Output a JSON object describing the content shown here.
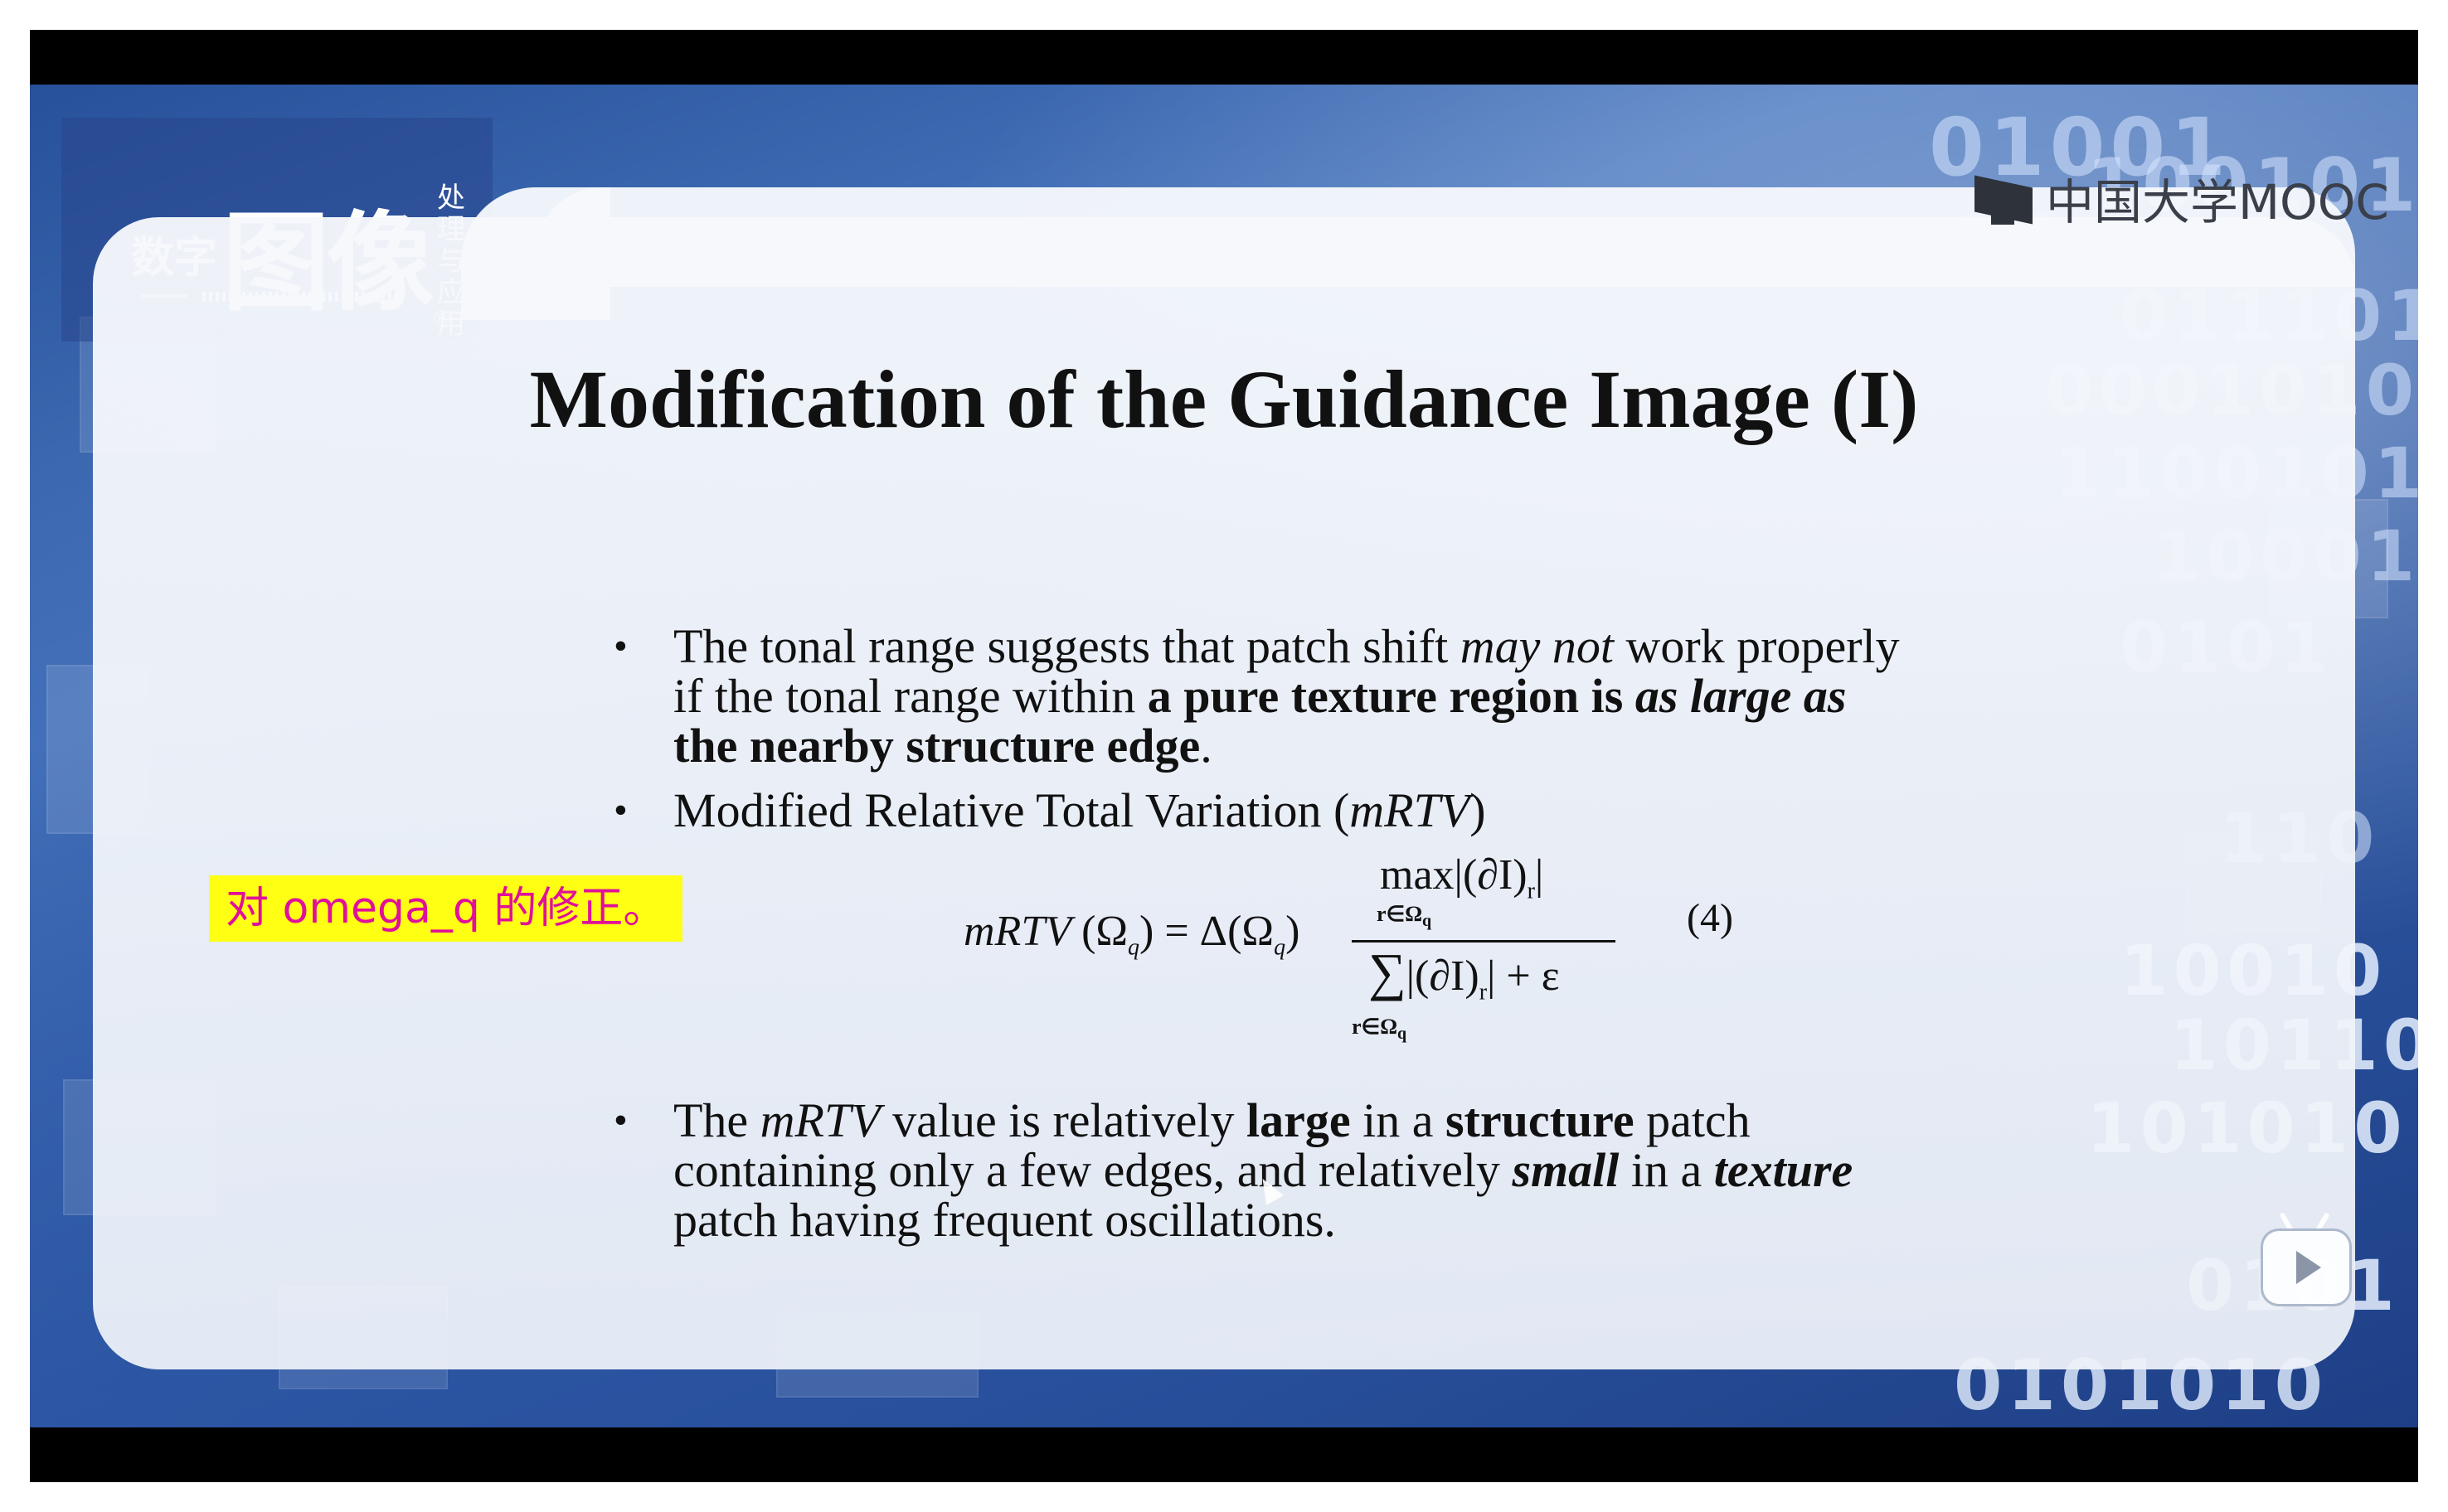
{
  "branding": {
    "logo_small": "数字",
    "logo_big": "图像",
    "logo_registered": "®",
    "logo_vertical": "处理与应用",
    "platform": "中国大学MOOC"
  },
  "slide": {
    "title": "Modification of the Guidance Image (I)",
    "bullet_marker": "•",
    "bullet1": {
      "t1": "The tonal range suggests that patch shift ",
      "t2": "may not",
      "t3": " work properly if the tonal range within ",
      "t4": "a pure texture region is ",
      "t5": "as large as",
      "t6": " the nearby structure edge",
      "t7": "."
    },
    "bullet2": {
      "t1": "Modified Relative Total Variation (",
      "t2": "mRTV",
      "t3": ")"
    },
    "formula": {
      "lhs_name": "mRTV",
      "lhs_arg": "(Ω",
      "lhs_sub": "q",
      "lhs_mid": ") = Δ(Ω",
      "lhs_sub2": "q",
      "lhs_end": ")",
      "numerator": "max|(∂I)",
      "numerator_sub": "r",
      "numerator_end": "|",
      "numerator_under": "r∈Ω",
      "numerator_under_sub": "q",
      "denominator_sigma": "∑",
      "denominator": "|(∂I)",
      "denominator_sub": "r",
      "denominator_end": "| + ε",
      "denominator_under": "r∈Ω",
      "denominator_under_sub": "q",
      "number": "(4)"
    },
    "bullet3": {
      "t1": "The ",
      "t2": "mRTV",
      "t3": " value is relatively ",
      "t4": "large",
      "t5": " in a ",
      "t6": "structure",
      "t7": " patch containing only a few edges, and relatively ",
      "t8": "small",
      "t9": " in a ",
      "t10": "texture",
      "t11": " patch having frequent oscillations."
    }
  },
  "subtitle": "对 omega_q 的修正。",
  "background_binary": [
    "01001",
    "100101",
    "011101",
    "0001010",
    "1100101",
    "10001",
    "0101",
    "110",
    "10010",
    "10110",
    "101010",
    "0101",
    "0101010"
  ],
  "colors": {
    "subtitle_bg": "#ffff14",
    "subtitle_text": "#e0109a",
    "background_blue": "#2f5aa6"
  }
}
